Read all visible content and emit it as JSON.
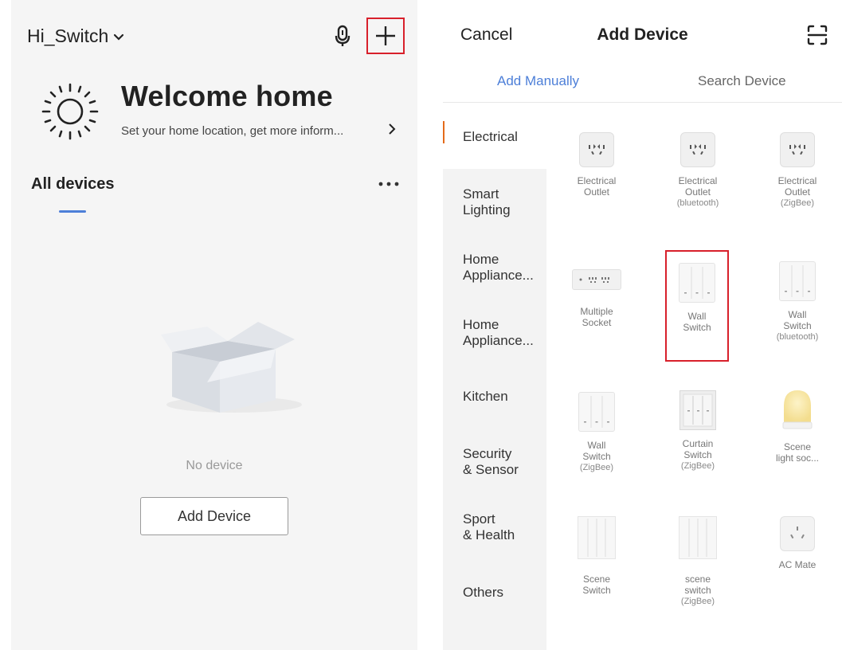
{
  "left": {
    "home_name": "Hi_Switch",
    "welcome_title": "Welcome home",
    "welcome_subtitle": "Set your home location, get more inform...",
    "section_title": "All devices",
    "empty_text": "No device",
    "add_device_label": "Add Device",
    "icons": {
      "dropdown": "chevron-down-icon",
      "mic": "microphone-icon",
      "add": "plus-icon",
      "sun": "sun-icon",
      "more": "more-dots-icon",
      "chevron": "chevron-right-icon",
      "empty": "empty-box-icon"
    }
  },
  "right": {
    "cancel_label": "Cancel",
    "title": "Add Device",
    "scan_icon": "scan-icon",
    "tabs": [
      {
        "label": "Add Manually",
        "active": true
      },
      {
        "label": "Search Device",
        "active": false
      }
    ],
    "categories": [
      {
        "label": "Electrical",
        "active": true
      },
      {
        "label": "Smart\nLighting",
        "active": false
      },
      {
        "label": "Home\nAppliance...",
        "active": false
      },
      {
        "label": "Home\nAppliance...",
        "active": false
      },
      {
        "label": "Kitchen",
        "active": false
      },
      {
        "label": "Security\n& Sensor",
        "active": false
      },
      {
        "label": "Sport\n& Health",
        "active": false
      },
      {
        "label": "Others",
        "active": false
      }
    ],
    "devices": [
      {
        "name": "Electrical\nOutlet",
        "sub": ""
      },
      {
        "name": "Electrical\nOutlet",
        "sub": "(bluetooth)"
      },
      {
        "name": "Electrical\nOutlet",
        "sub": "(ZigBee)"
      },
      {
        "name": "Multiple\nSocket",
        "sub": ""
      },
      {
        "name": "Wall\nSwitch",
        "sub": ""
      },
      {
        "name": "Wall\nSwitch",
        "sub": "(bluetooth)"
      },
      {
        "name": "Wall\nSwitch",
        "sub": "(ZigBee)"
      },
      {
        "name": "Curtain\nSwitch",
        "sub": "(ZigBee)"
      },
      {
        "name": "Scene\nlight soc...",
        "sub": ""
      },
      {
        "name": "Scene\nSwitch",
        "sub": ""
      },
      {
        "name": "scene\nswitch",
        "sub": "(ZigBee)"
      },
      {
        "name": "AC Mate",
        "sub": ""
      }
    ],
    "colors": {
      "accent": "#4d7fd8",
      "category_marker": "#e46b1a",
      "highlight": "#d8202b"
    }
  }
}
